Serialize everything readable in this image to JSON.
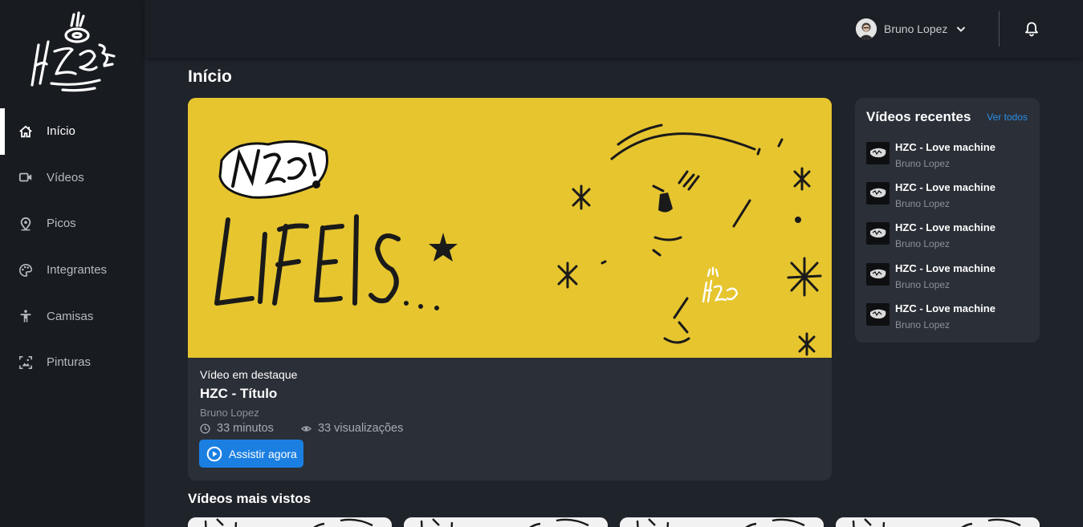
{
  "brand": {
    "logo_icon": "hzc-graffiti-logo"
  },
  "sidebar": {
    "items": [
      {
        "label": "Início",
        "icon": "home-icon",
        "active": true
      },
      {
        "label": "Vídeos",
        "icon": "video-camera-icon",
        "active": false
      },
      {
        "label": "Picos",
        "icon": "map-pin-icon",
        "active": false
      },
      {
        "label": "Integrantes",
        "icon": "palette-icon",
        "active": false
      },
      {
        "label": "Camisas",
        "icon": "person-icon",
        "active": false
      },
      {
        "label": "Pinturas",
        "icon": "picture-frame-icon",
        "active": false
      }
    ]
  },
  "header": {
    "user_name": "Bruno Lopez",
    "user_menu_icon": "chevron-down-icon",
    "notifications_icon": "bell-icon"
  },
  "page": {
    "title": "Início"
  },
  "featured": {
    "label": "Vídeo em destaque",
    "title": "HZC - Título",
    "author": "Bruno Lopez",
    "duration": "33 minutos",
    "views": "33 visualizações",
    "watch_label": "Assistir agora",
    "bg_color": "#e6c52f"
  },
  "recent": {
    "title": "Vídeos recentes",
    "see_all": "Ver todos",
    "items": [
      {
        "title": "HZC - Love machine",
        "author": "Bruno Lopez"
      },
      {
        "title": "HZC - Love machine",
        "author": "Bruno Lopez"
      },
      {
        "title": "HZC - Love machine",
        "author": "Bruno Lopez"
      },
      {
        "title": "HZC - Love machine",
        "author": "Bruno Lopez"
      },
      {
        "title": "HZC - Love machine",
        "author": "Bruno Lopez"
      }
    ]
  },
  "most_viewed": {
    "title": "Vídeos mais vistos",
    "card_count": 4
  },
  "colors": {
    "accent": "#1b7fe2",
    "link": "#2b8fe8",
    "background": "#1f232a",
    "sidebar": "#181b20",
    "card": "#2b2f37"
  }
}
